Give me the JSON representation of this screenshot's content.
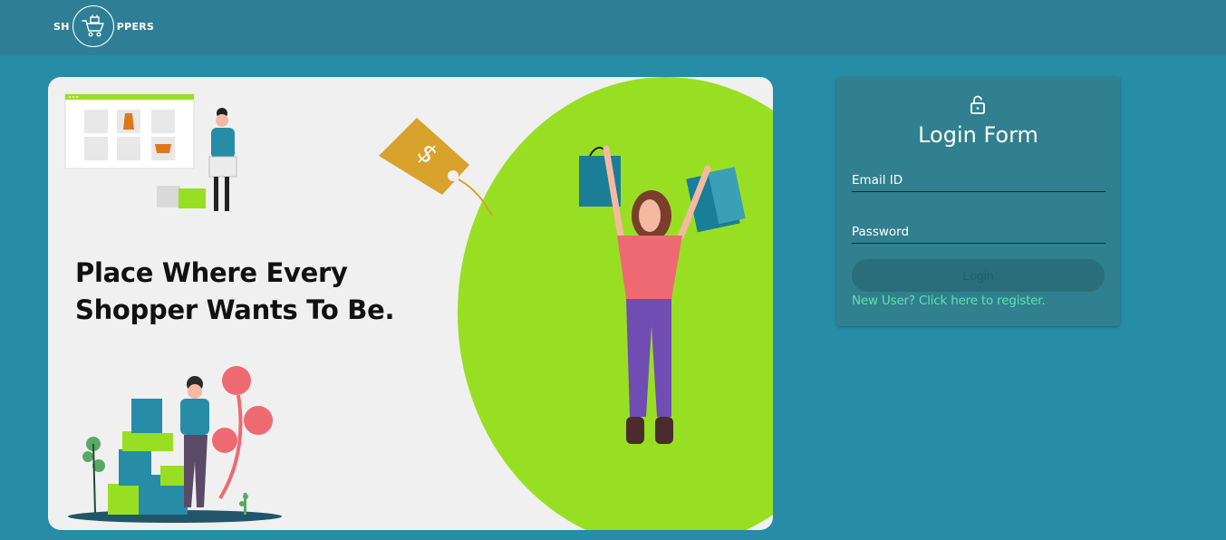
{
  "header": {
    "logo_prefix": "SH",
    "logo_suffix": "PPERS"
  },
  "hero": {
    "title_line1": "Place Where Every",
    "title_line2": "Shopper Wants To Be."
  },
  "login_form": {
    "icon": "lock-open-icon",
    "title": "Login Form",
    "email_label": "Email ID",
    "password_label": "Password",
    "login_label": "Login",
    "register_link": "New User? Click here to register."
  },
  "colors": {
    "background": "#278ca6",
    "header": "#2e7f95",
    "accent_green": "#98df23",
    "link_green": "#5fe3a8",
    "panel": "#30808f"
  }
}
